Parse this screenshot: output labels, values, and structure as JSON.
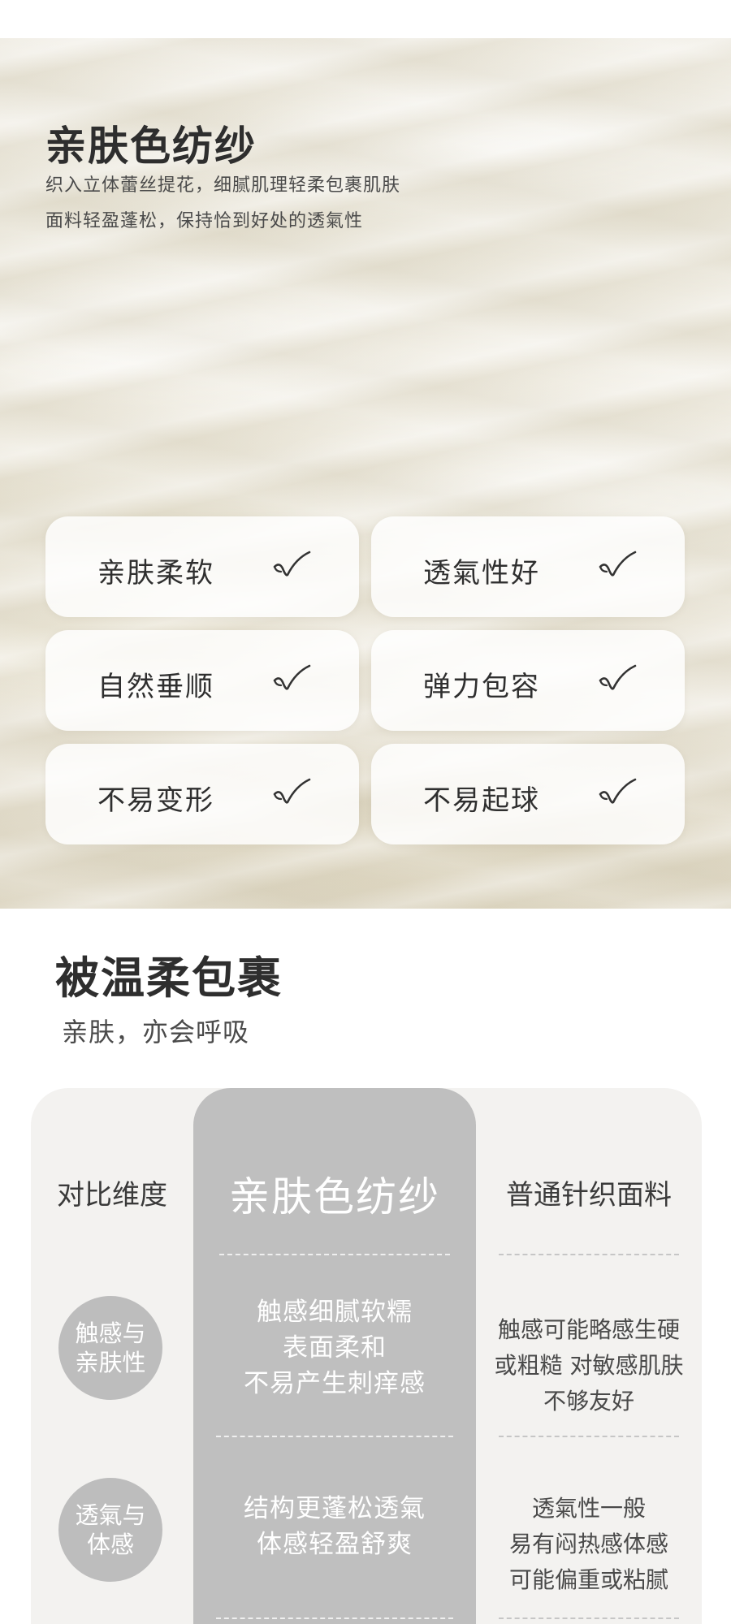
{
  "hero": {
    "title": "亲肤色纺纱",
    "desc_line1": "织入立体蕾丝提花，细腻肌理轻柔包裹肌肤",
    "desc_line2": "面料轻盈蓬松，保持恰到好处的透氣性",
    "features": [
      {
        "label": "亲肤柔软",
        "icon": "check-icon"
      },
      {
        "label": "透氣性好",
        "icon": "check-icon"
      },
      {
        "label": "自然垂顺",
        "icon": "check-icon"
      },
      {
        "label": "弹力包容",
        "icon": "check-icon"
      },
      {
        "label": "不易变形",
        "icon": "check-icon"
      },
      {
        "label": "不易起球",
        "icon": "check-icon"
      }
    ]
  },
  "section2": {
    "title": "被温柔包裹",
    "subtitle": "亲肤，亦会呼吸"
  },
  "comparison": {
    "header_dimension": "对比维度",
    "header_main": "亲肤色纺纱",
    "header_other": "普通针织面料",
    "rows": [
      {
        "dim_line1": "触感与",
        "dim_line2": "亲肤性",
        "main_line1": "触感细腻软糯",
        "main_line2": "表面柔和",
        "main_line3": "不易产生刺痒感",
        "other_line1": "触感可能略感生硬",
        "other_line2": "或粗糙 对敏感肌肤",
        "other_line3": "不够友好"
      },
      {
        "dim_line1": "透氣与",
        "dim_line2": "体感",
        "main_line1": "结构更蓬松透氣",
        "main_line2": "体感轻盈舒爽",
        "other_line1": "透氣性一般",
        "other_line2": "易有闷热感体感",
        "other_line3": "可能偏重或粘腻"
      }
    ]
  },
  "colors": {
    "accent_grey": "#bfbfbf",
    "table_bg": "#f3f2f0",
    "circle_grey": "#bdbdbd"
  }
}
